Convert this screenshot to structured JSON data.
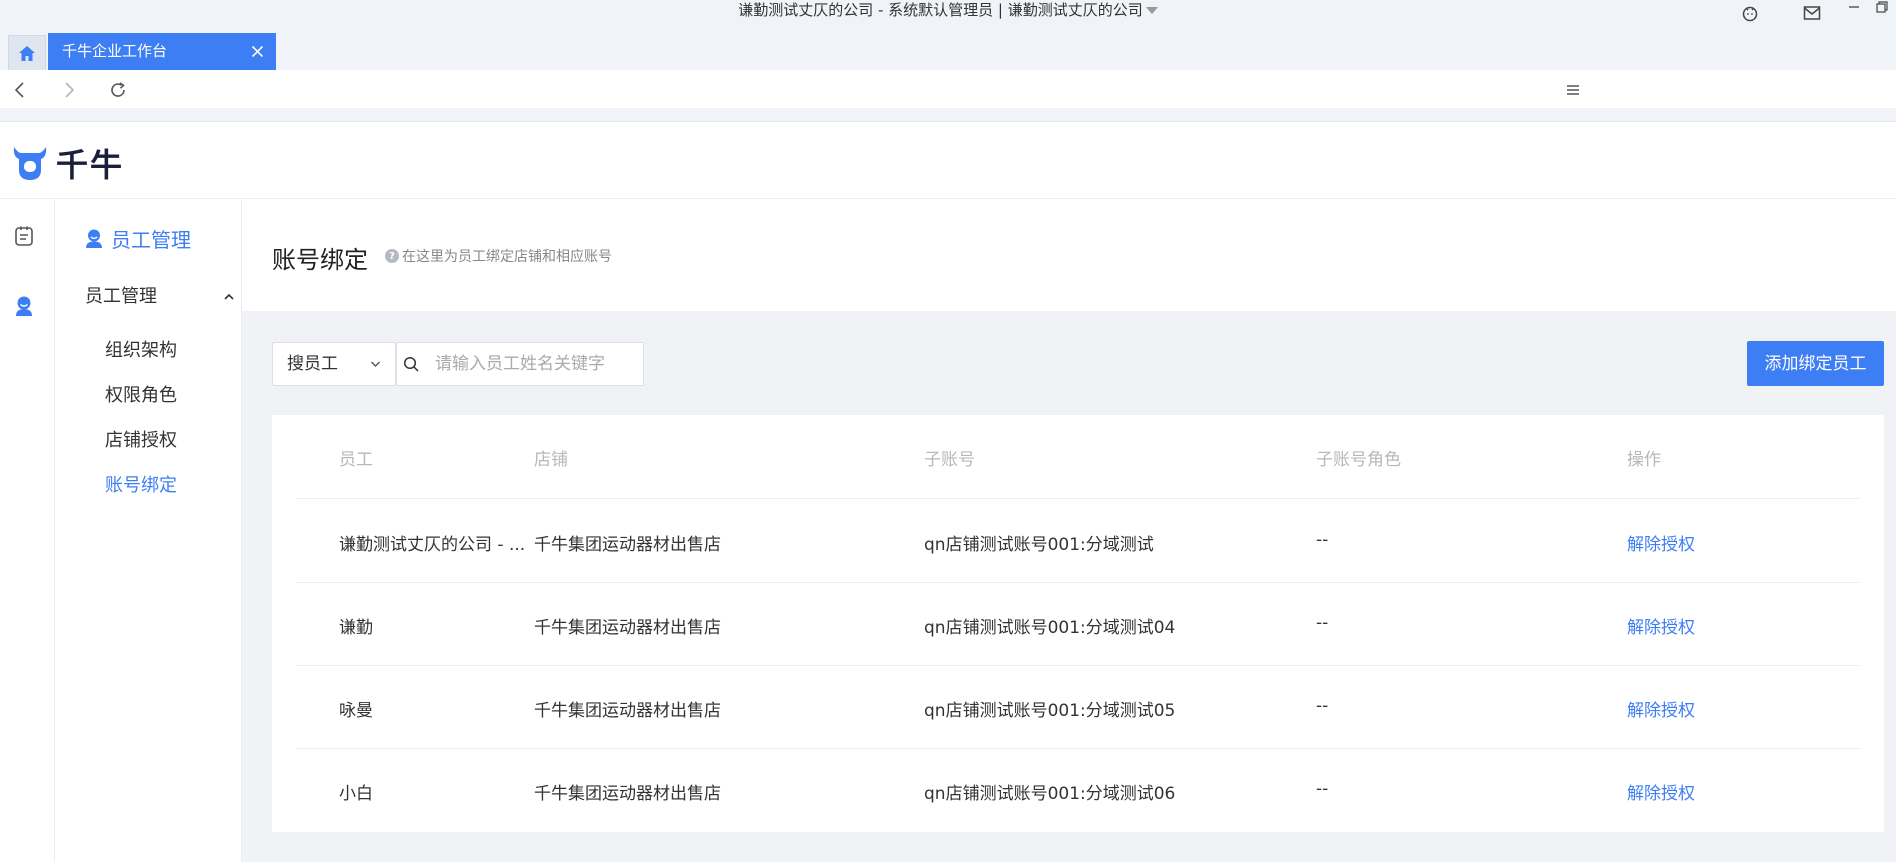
{
  "window": {
    "title": "谦勤测试丈仄的公司 - 系统默认管理员 | 谦勤测试丈仄的公司"
  },
  "tabs": {
    "active_label": "千牛企业工作台"
  },
  "header": {
    "logo_text": "千牛"
  },
  "sidebar": {
    "title": "员工管理",
    "group_label": "员工管理",
    "items": [
      {
        "label": "组织架构"
      },
      {
        "label": "权限角色"
      },
      {
        "label": "店铺授权"
      },
      {
        "label": "账号绑定"
      }
    ],
    "active_index": 3
  },
  "page": {
    "title": "账号绑定",
    "hint": "在这里为员工绑定店铺和相应账号"
  },
  "search": {
    "type_label": "搜员工",
    "placeholder": "请输入员工姓名关键字"
  },
  "toolbar": {
    "add_label": "添加绑定员工"
  },
  "table": {
    "columns": [
      "员工",
      "店铺",
      "子账号",
      "子账号角色",
      "操作"
    ],
    "rows": [
      {
        "employee": "谦勤测试丈仄的公司 - ...",
        "shop": "千牛集团运动器材出售店",
        "subaccount": "qn店铺测试账号001:分域测试",
        "role": "--",
        "action": "解除授权"
      },
      {
        "employee": "谦勤",
        "shop": "千牛集团运动器材出售店",
        "subaccount": "qn店铺测试账号001:分域测试04",
        "role": "--",
        "action": "解除授权"
      },
      {
        "employee": "咏曼",
        "shop": "千牛集团运动器材出售店",
        "subaccount": "qn店铺测试账号001:分域测试05",
        "role": "--",
        "action": "解除授权"
      },
      {
        "employee": "小白",
        "shop": "千牛集团运动器材出售店",
        "subaccount": "qn店铺测试账号001:分域测试06",
        "role": "--",
        "action": "解除授权"
      }
    ]
  },
  "colors": {
    "accent": "#3e7ef5",
    "chrome": "#f0f3f7",
    "content_bg": "#f0f2f5"
  }
}
